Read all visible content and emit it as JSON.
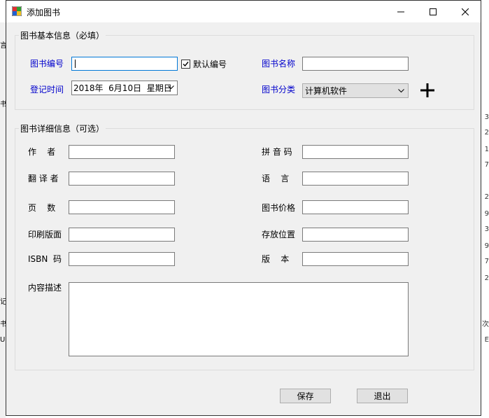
{
  "window": {
    "title": "添加图书"
  },
  "basic": {
    "title": "图书基本信息（必填）",
    "book_no_label": "图书编号",
    "book_no_value": "",
    "default_no_label": "默认编号",
    "default_no_checked": true,
    "book_name_label": "图书名称",
    "book_name_value": "",
    "reg_time_label": "登记时间",
    "reg_time_value": "2018年  6月10日  星期日",
    "category_label": "图书分类",
    "category_value": "计算机软件"
  },
  "detail": {
    "title": "图书详细信息（可选）",
    "author_label": "作    者",
    "pinyin_label": "拼 音 码",
    "translator_label": "翻 译 者",
    "language_label": "语    言",
    "pages_label": "页    数",
    "price_label": "图书价格",
    "edition_print_label": "印刷版面",
    "location_label": "存放位置",
    "isbn_label": "ISBN  码",
    "version_label": "版    本",
    "description_label": "内容描述"
  },
  "buttons": {
    "save": "保存",
    "exit": "退出"
  },
  "background_right_digits": [
    "3",
    "2",
    "1",
    "7",
    "2",
    "9",
    "3",
    "9",
    "7",
    "2",
    "次",
    "E"
  ],
  "background_left_chars": [
    "言",
    "书",
    "记",
    "书",
    "U"
  ]
}
